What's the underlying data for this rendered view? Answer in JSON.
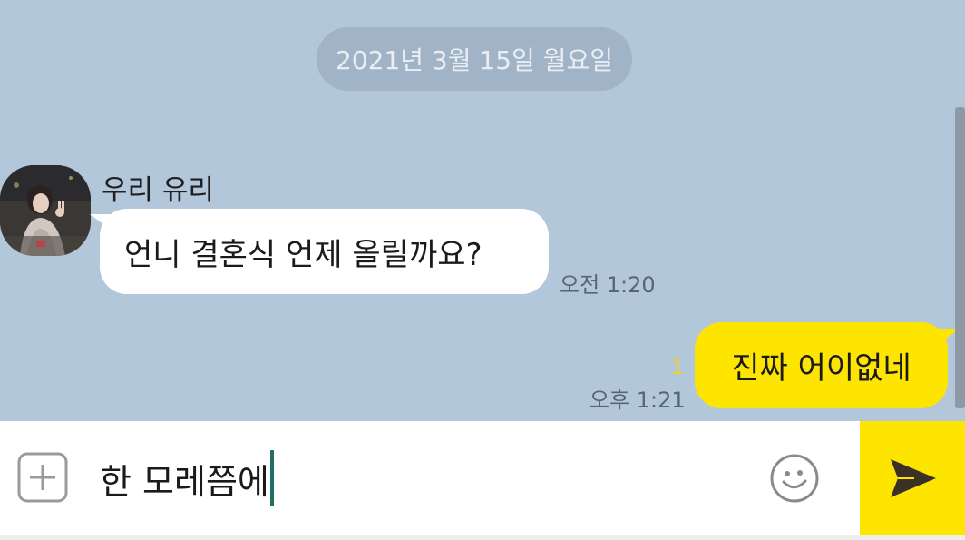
{
  "chat": {
    "date_divider": "2021년 3월 15일 월요일",
    "incoming": {
      "sender_name": "우리 유리",
      "message": "언니 결혼식 언제 올릴까요?",
      "time": "오전 1:20"
    },
    "outgoing": {
      "message": "진짜 어이없네",
      "unread_count": "1",
      "time": "오후 1:21"
    }
  },
  "composer": {
    "input_value": "한 모레쯤에",
    "icons": {
      "attach": "plus-icon",
      "emoji": "emoticon-icon",
      "send": "send-arrow-icon"
    }
  },
  "colors": {
    "chat_background": "#b2c7da",
    "my_bubble": "#fee500",
    "their_bubble": "#ffffff",
    "send_button": "#fee500",
    "unread_count": "#f4d21c",
    "caret": "#1f6f65"
  }
}
